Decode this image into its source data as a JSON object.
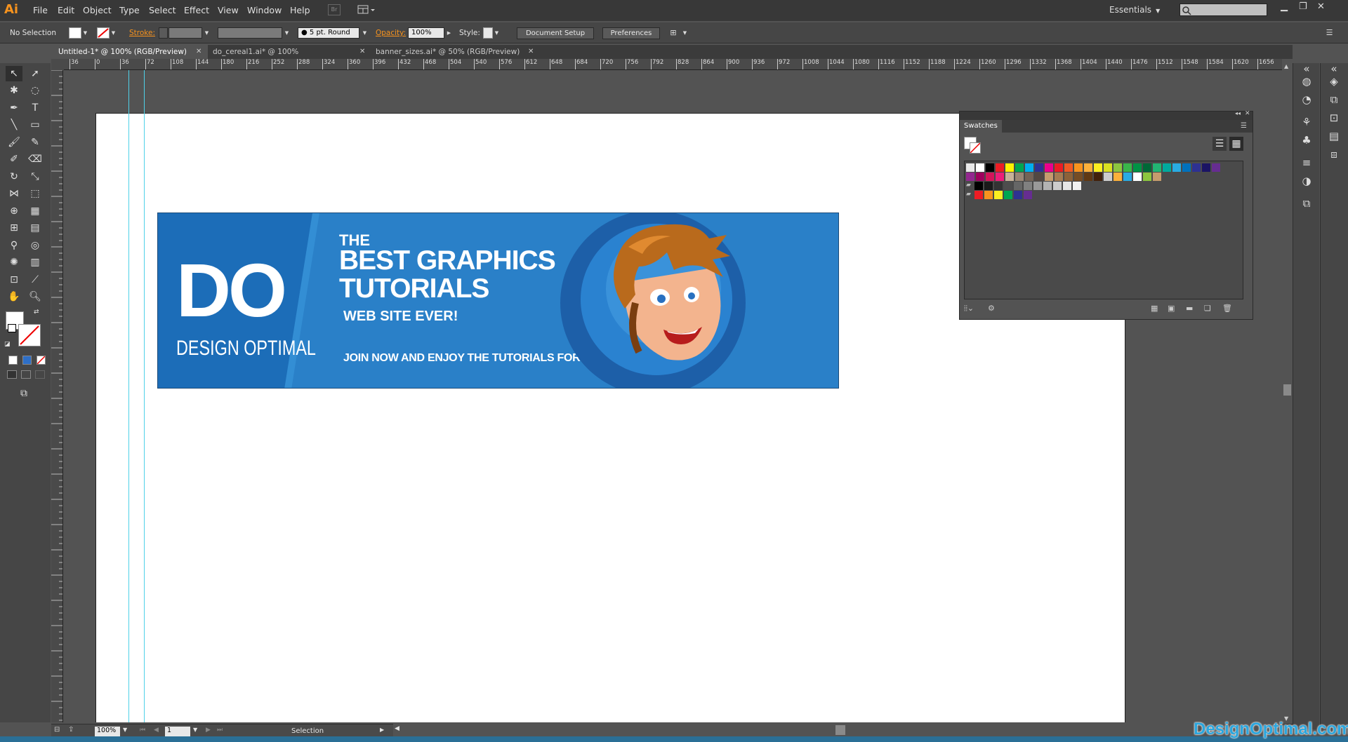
{
  "app": {
    "logo": "Ai"
  },
  "menubar": {
    "items": [
      "File",
      "Edit",
      "Object",
      "Type",
      "Select",
      "Effect",
      "View",
      "Window",
      "Help"
    ],
    "workspace": "Essentials",
    "bridge": "Br"
  },
  "controlbar": {
    "selection": "No Selection",
    "stroke_label": "Stroke:",
    "brush": "5 pt. Round",
    "opacity_label": "Opacity:",
    "opacity_value": "100%",
    "style_label": "Style:",
    "document_setup": "Document Setup",
    "preferences": "Preferences"
  },
  "tabs": [
    {
      "label": "Untitled-1* @ 100% (RGB/Preview)",
      "active": true
    },
    {
      "label": "do_cereal1.ai* @ 100% (RGB/Preview)",
      "active": false
    },
    {
      "label": "banner_sizes.ai* @ 50% (RGB/Preview)",
      "active": false
    }
  ],
  "ruler": {
    "ticks": [
      "36",
      "0",
      "36",
      "72",
      "108",
      "144",
      "180",
      "216",
      "252",
      "288",
      "324",
      "360",
      "396",
      "432",
      "468",
      "504",
      "540",
      "576",
      "612",
      "648",
      "684",
      "720",
      "756",
      "792",
      "828",
      "864",
      "900",
      "936",
      "972",
      "1008",
      "1044",
      "1080",
      "1116",
      "1152",
      "1188",
      "1224",
      "1260",
      "1296",
      "1332",
      "1368",
      "1404",
      "1440",
      "1476",
      "1512",
      "1548",
      "1584",
      "1620",
      "1656"
    ]
  },
  "banner": {
    "logo_letters": "DO",
    "logo_name": "DESIGN OPTIMAL",
    "line1": "THE",
    "line2": "BEST GRAPHICS",
    "line3": "TUTORIALS",
    "line4": "WEB SITE EVER!",
    "cta": "JOIN NOW AND ENJOY THE TUTORIALS FOR FREE"
  },
  "swatches": {
    "title": "Swatches",
    "row1": [
      "#e8e8e8",
      "#ffffff",
      "#000000",
      "#ed1c24",
      "#fff200",
      "#00a651",
      "#00aeef",
      "#2e3192",
      "#ec008c",
      "#ed1c24",
      "#f15a24",
      "#f7931e",
      "#fbb03b",
      "#fcee21",
      "#d9e021",
      "#8cc63f",
      "#39b54a",
      "#009245",
      "#006837",
      "#22b573",
      "#00a99d",
      "#29abe2",
      "#0071bc",
      "#2e3192",
      "#1b1464",
      "#662d91"
    ],
    "row2": [
      "#93278f",
      "#9e005d",
      "#d4145a",
      "#ed1e79",
      "#c7b299",
      "#998675",
      "#736357",
      "#534741",
      "#c69c6d",
      "#a67c52",
      "#8c6239",
      "#754c24",
      "#603813",
      "#42210b",
      "#cccccc",
      "#fbb03b",
      "#29abe2",
      "#ffffff",
      "#8cc63f",
      "#c69c6d"
    ],
    "row3": [
      "#000000",
      "#1a1a1a",
      "#333333",
      "#4d4d4d",
      "#666666",
      "#808080",
      "#999999",
      "#b3b3b3",
      "#cccccc",
      "#e6e6e6",
      "#f2f2f2"
    ],
    "row4": [
      "#ed1c24",
      "#f7931e",
      "#fcee21",
      "#00a651",
      "#2e3192",
      "#662d91"
    ]
  },
  "statusbar": {
    "zoom": "100%",
    "page": "1",
    "tool": "Selection"
  },
  "watermark": "DesignOptimal.com"
}
